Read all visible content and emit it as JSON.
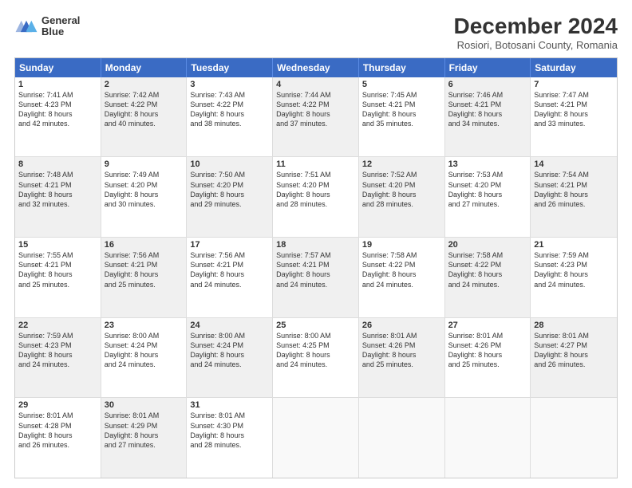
{
  "header": {
    "logo_line1": "General",
    "logo_line2": "Blue",
    "title": "December 2024",
    "subtitle": "Rosiori, Botosani County, Romania"
  },
  "days": [
    "Sunday",
    "Monday",
    "Tuesday",
    "Wednesday",
    "Thursday",
    "Friday",
    "Saturday"
  ],
  "weeks": [
    [
      {
        "num": "1",
        "lines": [
          "Sunrise: 7:41 AM",
          "Sunset: 4:23 PM",
          "Daylight: 8 hours",
          "and 42 minutes."
        ],
        "shaded": false
      },
      {
        "num": "2",
        "lines": [
          "Sunrise: 7:42 AM",
          "Sunset: 4:22 PM",
          "Daylight: 8 hours",
          "and 40 minutes."
        ],
        "shaded": true
      },
      {
        "num": "3",
        "lines": [
          "Sunrise: 7:43 AM",
          "Sunset: 4:22 PM",
          "Daylight: 8 hours",
          "and 38 minutes."
        ],
        "shaded": false
      },
      {
        "num": "4",
        "lines": [
          "Sunrise: 7:44 AM",
          "Sunset: 4:22 PM",
          "Daylight: 8 hours",
          "and 37 minutes."
        ],
        "shaded": true
      },
      {
        "num": "5",
        "lines": [
          "Sunrise: 7:45 AM",
          "Sunset: 4:21 PM",
          "Daylight: 8 hours",
          "and 35 minutes."
        ],
        "shaded": false
      },
      {
        "num": "6",
        "lines": [
          "Sunrise: 7:46 AM",
          "Sunset: 4:21 PM",
          "Daylight: 8 hours",
          "and 34 minutes."
        ],
        "shaded": true
      },
      {
        "num": "7",
        "lines": [
          "Sunrise: 7:47 AM",
          "Sunset: 4:21 PM",
          "Daylight: 8 hours",
          "and 33 minutes."
        ],
        "shaded": false
      }
    ],
    [
      {
        "num": "8",
        "lines": [
          "Sunrise: 7:48 AM",
          "Sunset: 4:21 PM",
          "Daylight: 8 hours",
          "and 32 minutes."
        ],
        "shaded": true
      },
      {
        "num": "9",
        "lines": [
          "Sunrise: 7:49 AM",
          "Sunset: 4:20 PM",
          "Daylight: 8 hours",
          "and 30 minutes."
        ],
        "shaded": false
      },
      {
        "num": "10",
        "lines": [
          "Sunrise: 7:50 AM",
          "Sunset: 4:20 PM",
          "Daylight: 8 hours",
          "and 29 minutes."
        ],
        "shaded": true
      },
      {
        "num": "11",
        "lines": [
          "Sunrise: 7:51 AM",
          "Sunset: 4:20 PM",
          "Daylight: 8 hours",
          "and 28 minutes."
        ],
        "shaded": false
      },
      {
        "num": "12",
        "lines": [
          "Sunrise: 7:52 AM",
          "Sunset: 4:20 PM",
          "Daylight: 8 hours",
          "and 28 minutes."
        ],
        "shaded": true
      },
      {
        "num": "13",
        "lines": [
          "Sunrise: 7:53 AM",
          "Sunset: 4:20 PM",
          "Daylight: 8 hours",
          "and 27 minutes."
        ],
        "shaded": false
      },
      {
        "num": "14",
        "lines": [
          "Sunrise: 7:54 AM",
          "Sunset: 4:21 PM",
          "Daylight: 8 hours",
          "and 26 minutes."
        ],
        "shaded": true
      }
    ],
    [
      {
        "num": "15",
        "lines": [
          "Sunrise: 7:55 AM",
          "Sunset: 4:21 PM",
          "Daylight: 8 hours",
          "and 25 minutes."
        ],
        "shaded": false
      },
      {
        "num": "16",
        "lines": [
          "Sunrise: 7:56 AM",
          "Sunset: 4:21 PM",
          "Daylight: 8 hours",
          "and 25 minutes."
        ],
        "shaded": true
      },
      {
        "num": "17",
        "lines": [
          "Sunrise: 7:56 AM",
          "Sunset: 4:21 PM",
          "Daylight: 8 hours",
          "and 24 minutes."
        ],
        "shaded": false
      },
      {
        "num": "18",
        "lines": [
          "Sunrise: 7:57 AM",
          "Sunset: 4:21 PM",
          "Daylight: 8 hours",
          "and 24 minutes."
        ],
        "shaded": true
      },
      {
        "num": "19",
        "lines": [
          "Sunrise: 7:58 AM",
          "Sunset: 4:22 PM",
          "Daylight: 8 hours",
          "and 24 minutes."
        ],
        "shaded": false
      },
      {
        "num": "20",
        "lines": [
          "Sunrise: 7:58 AM",
          "Sunset: 4:22 PM",
          "Daylight: 8 hours",
          "and 24 minutes."
        ],
        "shaded": true
      },
      {
        "num": "21",
        "lines": [
          "Sunrise: 7:59 AM",
          "Sunset: 4:23 PM",
          "Daylight: 8 hours",
          "and 24 minutes."
        ],
        "shaded": false
      }
    ],
    [
      {
        "num": "22",
        "lines": [
          "Sunrise: 7:59 AM",
          "Sunset: 4:23 PM",
          "Daylight: 8 hours",
          "and 24 minutes."
        ],
        "shaded": true
      },
      {
        "num": "23",
        "lines": [
          "Sunrise: 8:00 AM",
          "Sunset: 4:24 PM",
          "Daylight: 8 hours",
          "and 24 minutes."
        ],
        "shaded": false
      },
      {
        "num": "24",
        "lines": [
          "Sunrise: 8:00 AM",
          "Sunset: 4:24 PM",
          "Daylight: 8 hours",
          "and 24 minutes."
        ],
        "shaded": true
      },
      {
        "num": "25",
        "lines": [
          "Sunrise: 8:00 AM",
          "Sunset: 4:25 PM",
          "Daylight: 8 hours",
          "and 24 minutes."
        ],
        "shaded": false
      },
      {
        "num": "26",
        "lines": [
          "Sunrise: 8:01 AM",
          "Sunset: 4:26 PM",
          "Daylight: 8 hours",
          "and 25 minutes."
        ],
        "shaded": true
      },
      {
        "num": "27",
        "lines": [
          "Sunrise: 8:01 AM",
          "Sunset: 4:26 PM",
          "Daylight: 8 hours",
          "and 25 minutes."
        ],
        "shaded": false
      },
      {
        "num": "28",
        "lines": [
          "Sunrise: 8:01 AM",
          "Sunset: 4:27 PM",
          "Daylight: 8 hours",
          "and 26 minutes."
        ],
        "shaded": true
      }
    ],
    [
      {
        "num": "29",
        "lines": [
          "Sunrise: 8:01 AM",
          "Sunset: 4:28 PM",
          "Daylight: 8 hours",
          "and 26 minutes."
        ],
        "shaded": false
      },
      {
        "num": "30",
        "lines": [
          "Sunrise: 8:01 AM",
          "Sunset: 4:29 PM",
          "Daylight: 8 hours",
          "and 27 minutes."
        ],
        "shaded": true
      },
      {
        "num": "31",
        "lines": [
          "Sunrise: 8:01 AM",
          "Sunset: 4:30 PM",
          "Daylight: 8 hours",
          "and 28 minutes."
        ],
        "shaded": false
      },
      {
        "num": "",
        "lines": [],
        "shaded": true,
        "empty": true
      },
      {
        "num": "",
        "lines": [],
        "shaded": false,
        "empty": true
      },
      {
        "num": "",
        "lines": [],
        "shaded": true,
        "empty": true
      },
      {
        "num": "",
        "lines": [],
        "shaded": false,
        "empty": true
      }
    ]
  ]
}
